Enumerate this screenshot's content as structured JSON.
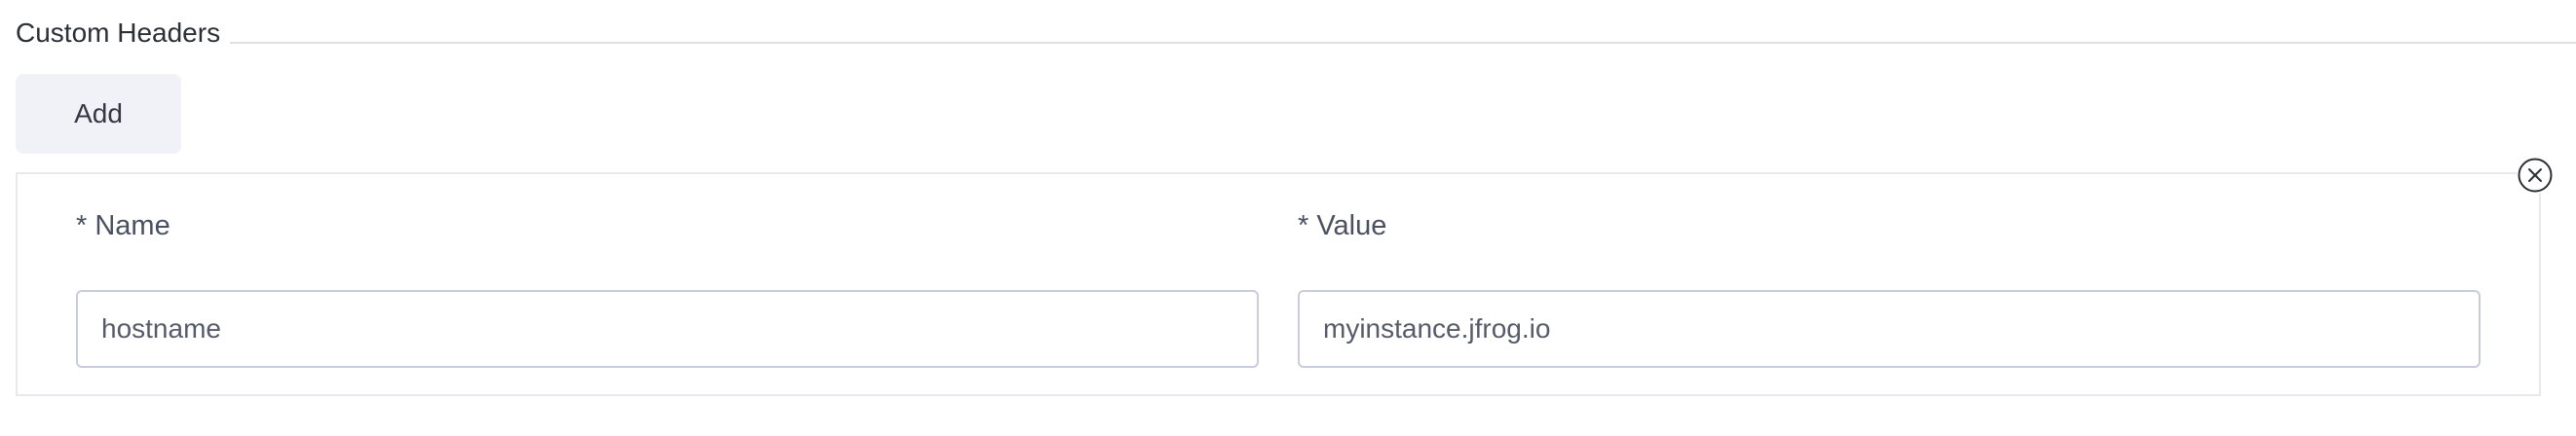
{
  "section": {
    "title": "Custom Headers",
    "add_label": "Add"
  },
  "headers": [
    {
      "name_label": "* Name",
      "name_value": "hostname",
      "value_label": "* Value",
      "value_value": "myinstance.jfrog.io",
      "remove_icon": "close-circle-icon"
    }
  ],
  "colors": {
    "button_background": "#f1f2f7",
    "input_border": "#c9ccdb",
    "card_border": "#e8e9ee",
    "label_text": "#4a5060"
  }
}
